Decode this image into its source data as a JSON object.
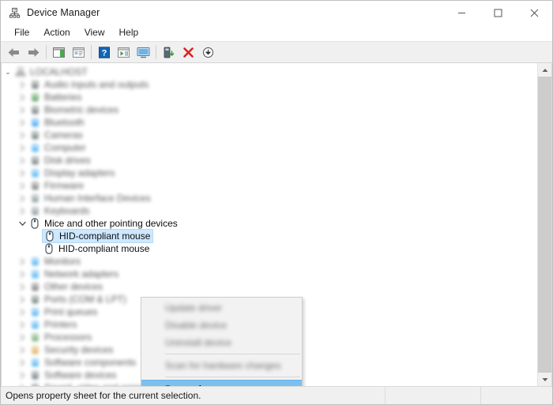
{
  "window": {
    "title": "Device Manager",
    "app_icon": "device-manager-icon",
    "controls": {
      "minimize": "─",
      "maximize": "☐",
      "close": "✕"
    }
  },
  "menubar": {
    "items": [
      {
        "label": "File",
        "name": "menu-file"
      },
      {
        "label": "Action",
        "name": "menu-action"
      },
      {
        "label": "View",
        "name": "menu-view"
      },
      {
        "label": "Help",
        "name": "menu-help"
      }
    ]
  },
  "toolbar": {
    "buttons": [
      {
        "icon": "back-arrow-icon",
        "tooltip": "Back"
      },
      {
        "icon": "forward-arrow-icon",
        "tooltip": "Forward"
      },
      {
        "icon": "show-hide-console-tree-icon",
        "tooltip": "Show/Hide Console Tree"
      },
      {
        "icon": "properties-icon",
        "tooltip": "Properties"
      },
      {
        "icon": "help-icon",
        "tooltip": "Help"
      },
      {
        "icon": "view-icon",
        "tooltip": "View"
      },
      {
        "icon": "update-driver-icon",
        "tooltip": "Update driver"
      },
      {
        "icon": "scan-for-hardware-changes-icon",
        "tooltip": "Scan for hardware changes"
      },
      {
        "icon": "uninstall-device-icon",
        "tooltip": "Uninstall device"
      },
      {
        "icon": "download-icon",
        "tooltip": "Download"
      }
    ]
  },
  "tree": {
    "root": {
      "label": "LOCALHOST",
      "blurred": true,
      "expanded": true,
      "icon": "computer-icon"
    },
    "nodes": [
      {
        "label": "Audio inputs and outputs",
        "blurred": true,
        "icon": "speaker-icon",
        "color": "#5f6a6a"
      },
      {
        "label": "Batteries",
        "blurred": true,
        "icon": "battery-icon",
        "color": "#3f8f3f"
      },
      {
        "label": "Biometric devices",
        "blurred": true,
        "icon": "fingerprint-icon",
        "color": "#5f6a6a"
      },
      {
        "label": "Bluetooth",
        "blurred": true,
        "icon": "bluetooth-icon",
        "color": "#2196f3"
      },
      {
        "label": "Cameras",
        "blurred": true,
        "icon": "camera-icon",
        "color": "#5f6a6a"
      },
      {
        "label": "Computer",
        "blurred": true,
        "icon": "computer-icon",
        "color": "#36a8f0"
      },
      {
        "label": "Disk drives",
        "blurred": true,
        "icon": "disk-icon",
        "color": "#5f6a6a"
      },
      {
        "label": "Display adapters",
        "blurred": true,
        "icon": "display-icon",
        "color": "#36a8f0"
      },
      {
        "label": "Firmware",
        "blurred": true,
        "icon": "firmware-icon",
        "color": "#6b6b6b"
      },
      {
        "label": "Human Interface Devices",
        "blurred": true,
        "icon": "hid-icon",
        "color": "#7a8a8a"
      },
      {
        "label": "Keyboards",
        "blurred": true,
        "icon": "keyboard-icon",
        "color": "#7a8a8a"
      },
      {
        "label": "Mice and other pointing devices",
        "blurred": false,
        "icon": "mouse-icon",
        "color": "#4a5560",
        "expanded": true
      },
      {
        "label": "HID-compliant mouse",
        "blurred": false,
        "icon": "mouse-icon",
        "color": "#4a5560",
        "child": true,
        "selected": true
      },
      {
        "label": "HID-compliant mouse",
        "blurred": false,
        "icon": "mouse-icon",
        "color": "#4a5560",
        "child": true,
        "selected": false
      },
      {
        "label": "Monitors",
        "blurred": true,
        "icon": "monitor-icon",
        "color": "#36a8f0"
      },
      {
        "label": "Network adapters",
        "blurred": true,
        "icon": "network-icon",
        "color": "#36a8f0"
      },
      {
        "label": "Other devices",
        "blurred": true,
        "icon": "other-device-icon",
        "color": "#6b6b6b"
      },
      {
        "label": "Ports (COM & LPT)",
        "blurred": true,
        "icon": "port-icon",
        "color": "#5f6a6a"
      },
      {
        "label": "Print queues",
        "blurred": true,
        "icon": "print-queue-icon",
        "color": "#36a8f0"
      },
      {
        "label": "Printers",
        "blurred": true,
        "icon": "printer-icon",
        "color": "#36a8f0"
      },
      {
        "label": "Processors",
        "blurred": true,
        "icon": "processor-icon",
        "color": "#5f9f5f"
      },
      {
        "label": "Security devices",
        "blurred": true,
        "icon": "security-icon",
        "color": "#d9a441"
      },
      {
        "label": "Software components",
        "blurred": true,
        "icon": "software-component-icon",
        "color": "#36a8f0"
      },
      {
        "label": "Software devices",
        "blurred": true,
        "icon": "software-device-icon",
        "color": "#5f6a6a"
      },
      {
        "label": "Sound, video and game controllers",
        "blurred": true,
        "icon": "sound-icon",
        "color": "#5f6a6a"
      }
    ]
  },
  "context_menu": {
    "items": [
      {
        "label": "Update driver",
        "blurred": true,
        "highlighted": false
      },
      {
        "label": "Disable device",
        "blurred": true,
        "highlighted": false
      },
      {
        "label": "Uninstall device",
        "blurred": true,
        "highlighted": false
      },
      {
        "separator": true
      },
      {
        "label": "Scan for hardware changes",
        "blurred": true,
        "highlighted": false
      },
      {
        "separator": true
      },
      {
        "label": "Properties",
        "blurred": false,
        "highlighted": true
      }
    ]
  },
  "statusbar": {
    "message": "Opens property sheet for the current selection."
  },
  "colors": {
    "selection_blue": "#cde8ff",
    "menu_highlight_blue": "#7cc0ef",
    "toolbar_bg": "#f0f0f0",
    "uninstall_red": "#e02020",
    "scan_green": "#3ca03c"
  },
  "scrollbar": {
    "up_arrow": "⌃",
    "down_arrow": "⌄"
  }
}
